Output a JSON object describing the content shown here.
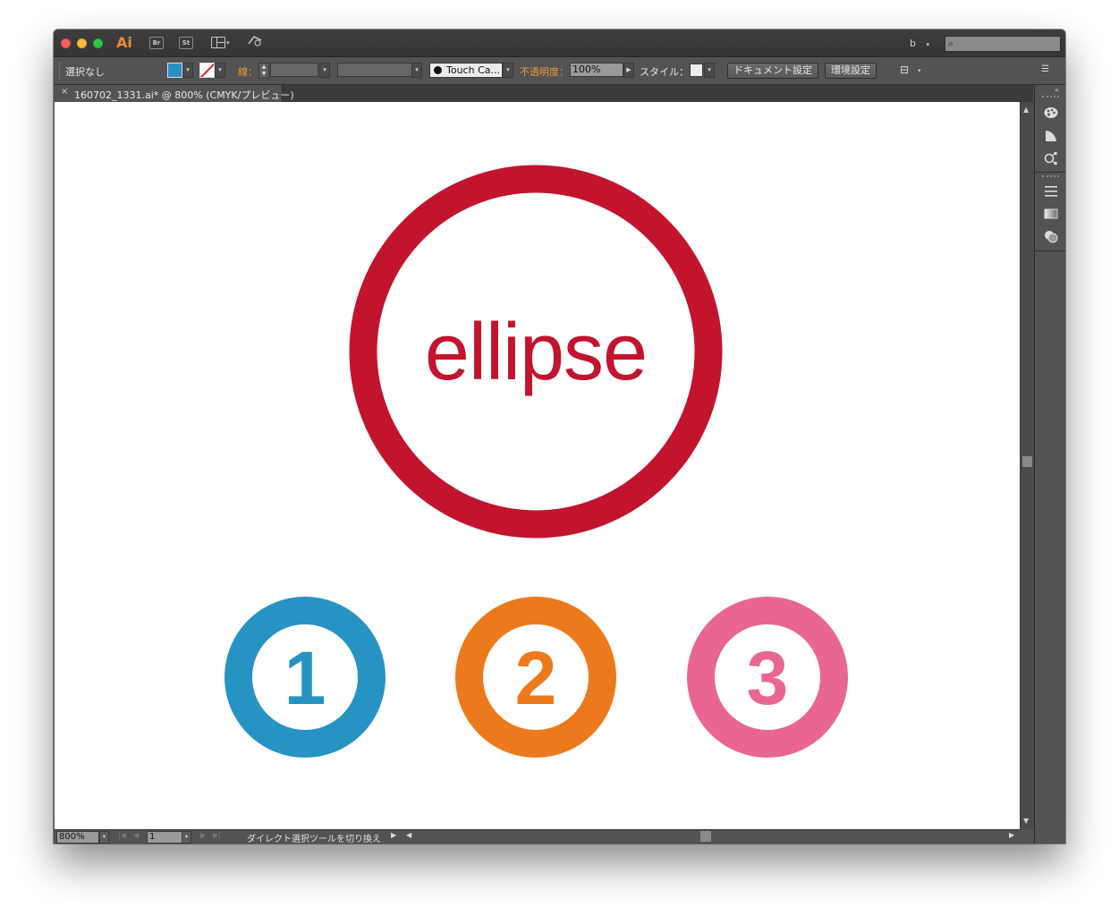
{
  "titlebar": {
    "app_logo": "Ai",
    "bridge_label": "Br",
    "stock_label": "St",
    "workspace_name": "b",
    "search_placeholder": ""
  },
  "controlbar": {
    "selection_label": "選択なし",
    "stroke_label": "線：",
    "brush_name": "Touch Ca...",
    "opacity_label": "不透明度：",
    "opacity_value": "100%",
    "style_label": "スタイル：",
    "document_setup_label": "ドキュメント設定",
    "preferences_label": "環境設定",
    "fill_color": "#2a8fc4",
    "stroke_color": "none"
  },
  "document_tab": {
    "close_glyph": "×",
    "title": "160702_1331.ai* @ 800% (CMYK/プレビュー)"
  },
  "artwork": {
    "main_word": "ellipse",
    "main_color": "#c3142d",
    "badges": [
      {
        "number": "1",
        "color": "#2793c3"
      },
      {
        "number": "2",
        "color": "#ec7a1c"
      },
      {
        "number": "3",
        "color": "#e96592"
      }
    ]
  },
  "statusbar": {
    "zoom": "800%",
    "page": "1",
    "status_text": "ダイレクト選択ツールを切り換え"
  },
  "icons": {
    "close": "×",
    "search": "⌕",
    "caret": "▾",
    "up": "▲",
    "down": "▼",
    "left": "◀",
    "right": "▶",
    "collapse": "«",
    "menu": "☰"
  }
}
